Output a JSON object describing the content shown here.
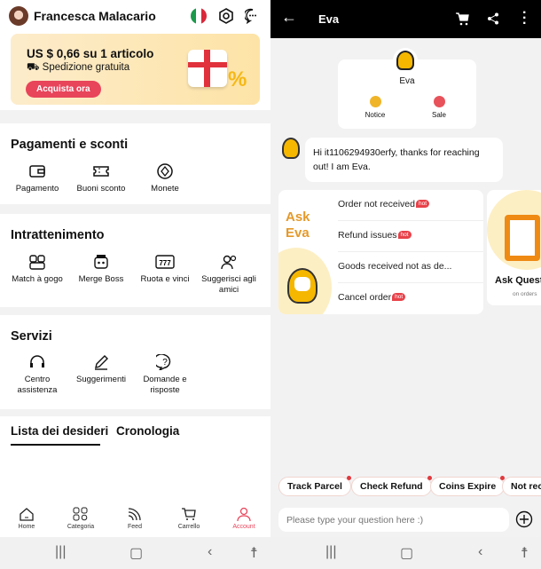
{
  "left": {
    "profile": {
      "name": "Francesca Malacario"
    },
    "header_icons": [
      "italy-flag-icon",
      "settings-icon",
      "messages-icon"
    ],
    "banner": {
      "title": "US $ 0,66 su 1 articolo",
      "shipping": "Spedizione gratuita",
      "button": "Acquista ora"
    },
    "sections": [
      {
        "title": "Pagamenti e sconti",
        "items": [
          {
            "label": "Pagamento",
            "icon": "wallet-icon"
          },
          {
            "label": "Buoni sconto",
            "icon": "coupon-icon"
          },
          {
            "label": "Monete",
            "icon": "coin-icon"
          }
        ]
      },
      {
        "title": "Intrattenimento",
        "items": [
          {
            "label": "Match à gogo",
            "icon": "puzzle-icon"
          },
          {
            "label": "Merge Boss",
            "icon": "boss-icon"
          },
          {
            "label": "Ruota e vinci",
            "icon": "slot-777-icon"
          },
          {
            "label": "Suggerisci agli amici",
            "icon": "invite-friends-icon"
          }
        ]
      },
      {
        "title": "Servizi",
        "items": [
          {
            "label": "Centro assistenza",
            "icon": "headset-icon"
          },
          {
            "label": "Suggerimenti",
            "icon": "pen-icon"
          },
          {
            "label": "Domande e risposte",
            "icon": "question-icon"
          }
        ]
      }
    ],
    "tabs": [
      {
        "label": "Lista dei desideri",
        "active": true
      },
      {
        "label": "Cronologia",
        "active": false
      }
    ],
    "bottom_nav": [
      {
        "label": "Home"
      },
      {
        "label": "Categoria"
      },
      {
        "label": "Feed"
      },
      {
        "label": "Carrello"
      },
      {
        "label": "Account",
        "active": true
      }
    ],
    "accent": "#e8445a"
  },
  "right": {
    "header": {
      "title": "Eva",
      "icons": [
        "back-arrow-icon",
        "cart-icon",
        "share-icon",
        "more-icon"
      ]
    },
    "profile_card": {
      "name": "Eva",
      "actions": [
        {
          "label": "Notice",
          "color": "#f0b429"
        },
        {
          "label": "Sale",
          "color": "#e8525a"
        }
      ]
    },
    "message": "Hi it1106294930erfy, thanks for reaching out! I am Eva.",
    "ask_card": {
      "title_line1": "Ask",
      "title_line2": "Eva",
      "questions": [
        {
          "label": "Order not received",
          "hot": "hot"
        },
        {
          "label": "Refund issues",
          "hot": "hot"
        },
        {
          "label": "Goods received not as de...",
          "hot": null
        },
        {
          "label": "Cancel order",
          "hot": "hot"
        }
      ]
    },
    "side_card": {
      "title": "Ask Quest",
      "subtitle": "on orders"
    },
    "chips": [
      "Track Parcel",
      "Check Refund",
      "Coins Expire",
      "Not rec"
    ],
    "input": {
      "placeholder": "Please type your question here :)",
      "value": ""
    }
  }
}
